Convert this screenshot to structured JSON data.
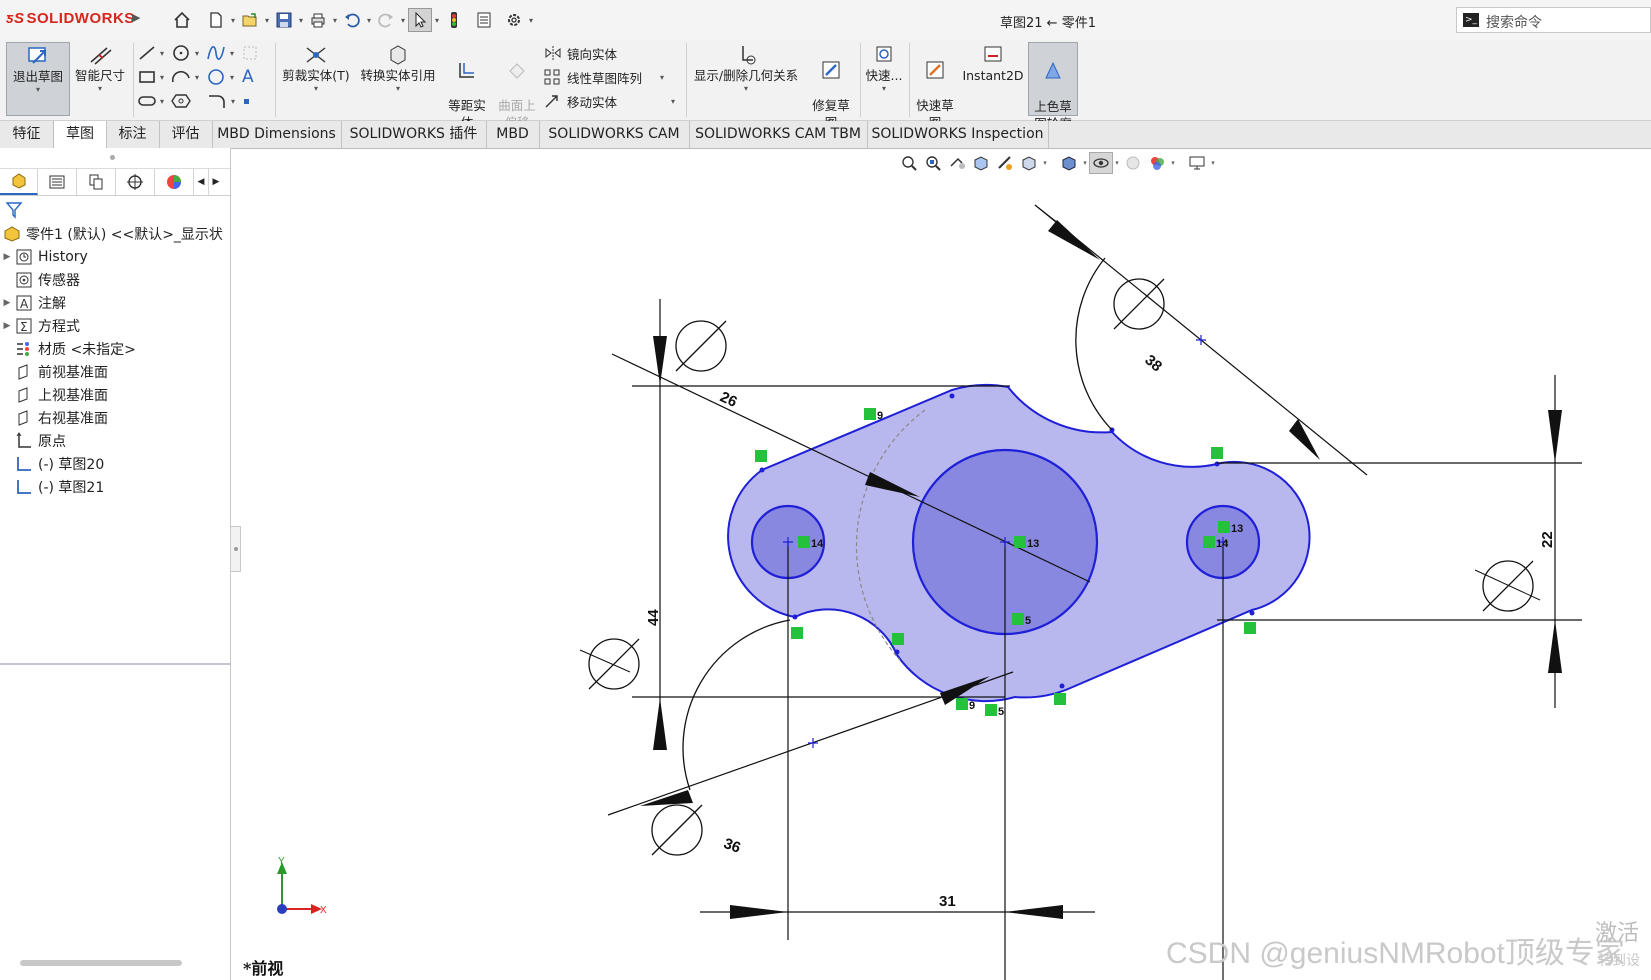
{
  "app": {
    "logo": "SOLIDWORKS",
    "window_title": "草图21 ← 零件1",
    "search_placeholder": "搜索命令"
  },
  "ribbon": {
    "exit_sketch": "退出草图",
    "smart_dimension": "智能尺寸",
    "trim_entities": "剪裁实体(T)",
    "convert_entities": "转换实体引用",
    "offset_entities": "等距实\n体",
    "offset_on_surface": "曲面上\n偏移",
    "mirror_entities": "镜向实体",
    "linear_pattern": "线性草图阵列",
    "move_entities": "移动实体",
    "display_delete_relations": "显示/删除几何关系",
    "repair_sketch": "修复草\n图",
    "quick_snaps": "快速...",
    "rapid_sketch": "快速草\n图",
    "instant2d": "Instant2D",
    "shaded_contours": "上色草\n图轮廓"
  },
  "tabs": [
    "特征",
    "草图",
    "标注",
    "评估",
    "MBD Dimensions",
    "SOLIDWORKS 插件",
    "MBD",
    "SOLIDWORKS CAM",
    "SOLIDWORKS CAM TBM",
    "SOLIDWORKS Inspection"
  ],
  "active_tab": "草图",
  "tree": {
    "root": "零件1 (默认) <<默认>_显示状",
    "items": [
      {
        "label": "History",
        "expandable": true,
        "icon": "history-icon"
      },
      {
        "label": "传感器",
        "expandable": false,
        "icon": "sensor-icon"
      },
      {
        "label": "注解",
        "expandable": true,
        "icon": "annotation-icon"
      },
      {
        "label": "方程式",
        "expandable": true,
        "icon": "equation-icon"
      },
      {
        "label": "材质 <未指定>",
        "expandable": false,
        "icon": "material-icon"
      },
      {
        "label": "前视基准面",
        "expandable": false,
        "icon": "plane-icon"
      },
      {
        "label": "上视基准面",
        "expandable": false,
        "icon": "plane-icon"
      },
      {
        "label": "右视基准面",
        "expandable": false,
        "icon": "plane-icon"
      },
      {
        "label": "原点",
        "expandable": false,
        "icon": "origin-icon"
      },
      {
        "label": "(-) 草图20",
        "expandable": false,
        "icon": "sketch-icon"
      },
      {
        "label": "(-) 草图21",
        "expandable": false,
        "icon": "sketch-icon"
      }
    ]
  },
  "drawing": {
    "dimensions": {
      "d26": "26",
      "d38": "38",
      "d44": "44",
      "d22": "22",
      "d36": "36",
      "d31": "31"
    },
    "relation_tags": {
      "r9a": "9",
      "r14a": "14",
      "r13a": "13",
      "r13b": "13",
      "r14b": "14",
      "r5a": "5",
      "r9b": "9",
      "r5b": "5"
    },
    "triad_y": "Y",
    "triad_x": "X",
    "colors": {
      "sketch_line": "#1f1fd8",
      "fill_light": "#b9b9ee",
      "fill_dark": "#8c8ce3",
      "relation": "#23c23a"
    }
  },
  "view_name": "*前视",
  "watermark": "CSDN @geniusNMRobot顶级专家",
  "activate_text": "激活",
  "activate_sub": "转到设"
}
